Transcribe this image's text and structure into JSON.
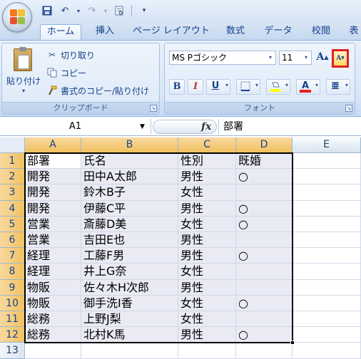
{
  "quick_access": {
    "save_icon": "save-icon",
    "undo_icon": "undo-icon",
    "redo_icon": "redo-icon",
    "print_preview_icon": "print-preview-icon",
    "customize_icon": "customize-qat-icon"
  },
  "tabs": [
    {
      "label": "ホーム",
      "active": true
    },
    {
      "label": "挿入"
    },
    {
      "label": "ページ レイアウト"
    },
    {
      "label": "数式"
    },
    {
      "label": "データ"
    },
    {
      "label": "校閲"
    },
    {
      "label": "表"
    }
  ],
  "clipboard_group": {
    "paste_label": "貼り付け",
    "cut_label": "切り取り",
    "copy_label": "コピー",
    "format_painter_label": "書式のコピー/貼り付け",
    "group_label": "クリップボード"
  },
  "font_group": {
    "font_name": "MS Pゴシック",
    "font_size": "11",
    "grow_label": "A",
    "shrink_label": "A",
    "bold_label": "B",
    "italic_label": "I",
    "underline_label": "U",
    "fill_color": "#ffff00",
    "font_color": "#e51e1e",
    "phonetic_label": "亜",
    "group_label": "フォント"
  },
  "formula_bar": {
    "name_box": "A1",
    "fx_label": "fx",
    "formula": "部署"
  },
  "sheet": {
    "columns": [
      "A",
      "B",
      "C",
      "D",
      "E"
    ],
    "row_numbers": [
      "1",
      "2",
      "3",
      "4",
      "5",
      "6",
      "7",
      "8",
      "9",
      "10",
      "11",
      "12",
      "13"
    ],
    "rows": [
      [
        "部署",
        "氏名",
        "性別",
        "既婚"
      ],
      [
        "開発",
        "田中A太郎",
        "男性",
        "○"
      ],
      [
        "開発",
        "鈴木B子",
        "女性",
        ""
      ],
      [
        "開発",
        "伊藤C平",
        "男性",
        "○"
      ],
      [
        "営業",
        "斎藤D美",
        "女性",
        "○"
      ],
      [
        "営業",
        "吉田E也",
        "男性",
        ""
      ],
      [
        "経理",
        "工藤F男",
        "男性",
        "○"
      ],
      [
        "経理",
        "井上G奈",
        "女性",
        ""
      ],
      [
        "物販",
        "佐々木H次郎",
        "男性",
        ""
      ],
      [
        "物販",
        "御手洗I香",
        "女性",
        "○"
      ],
      [
        "総務",
        "上野J梨",
        "女性",
        ""
      ],
      [
        "総務",
        "北村K馬",
        "男性",
        "○"
      ]
    ]
  }
}
